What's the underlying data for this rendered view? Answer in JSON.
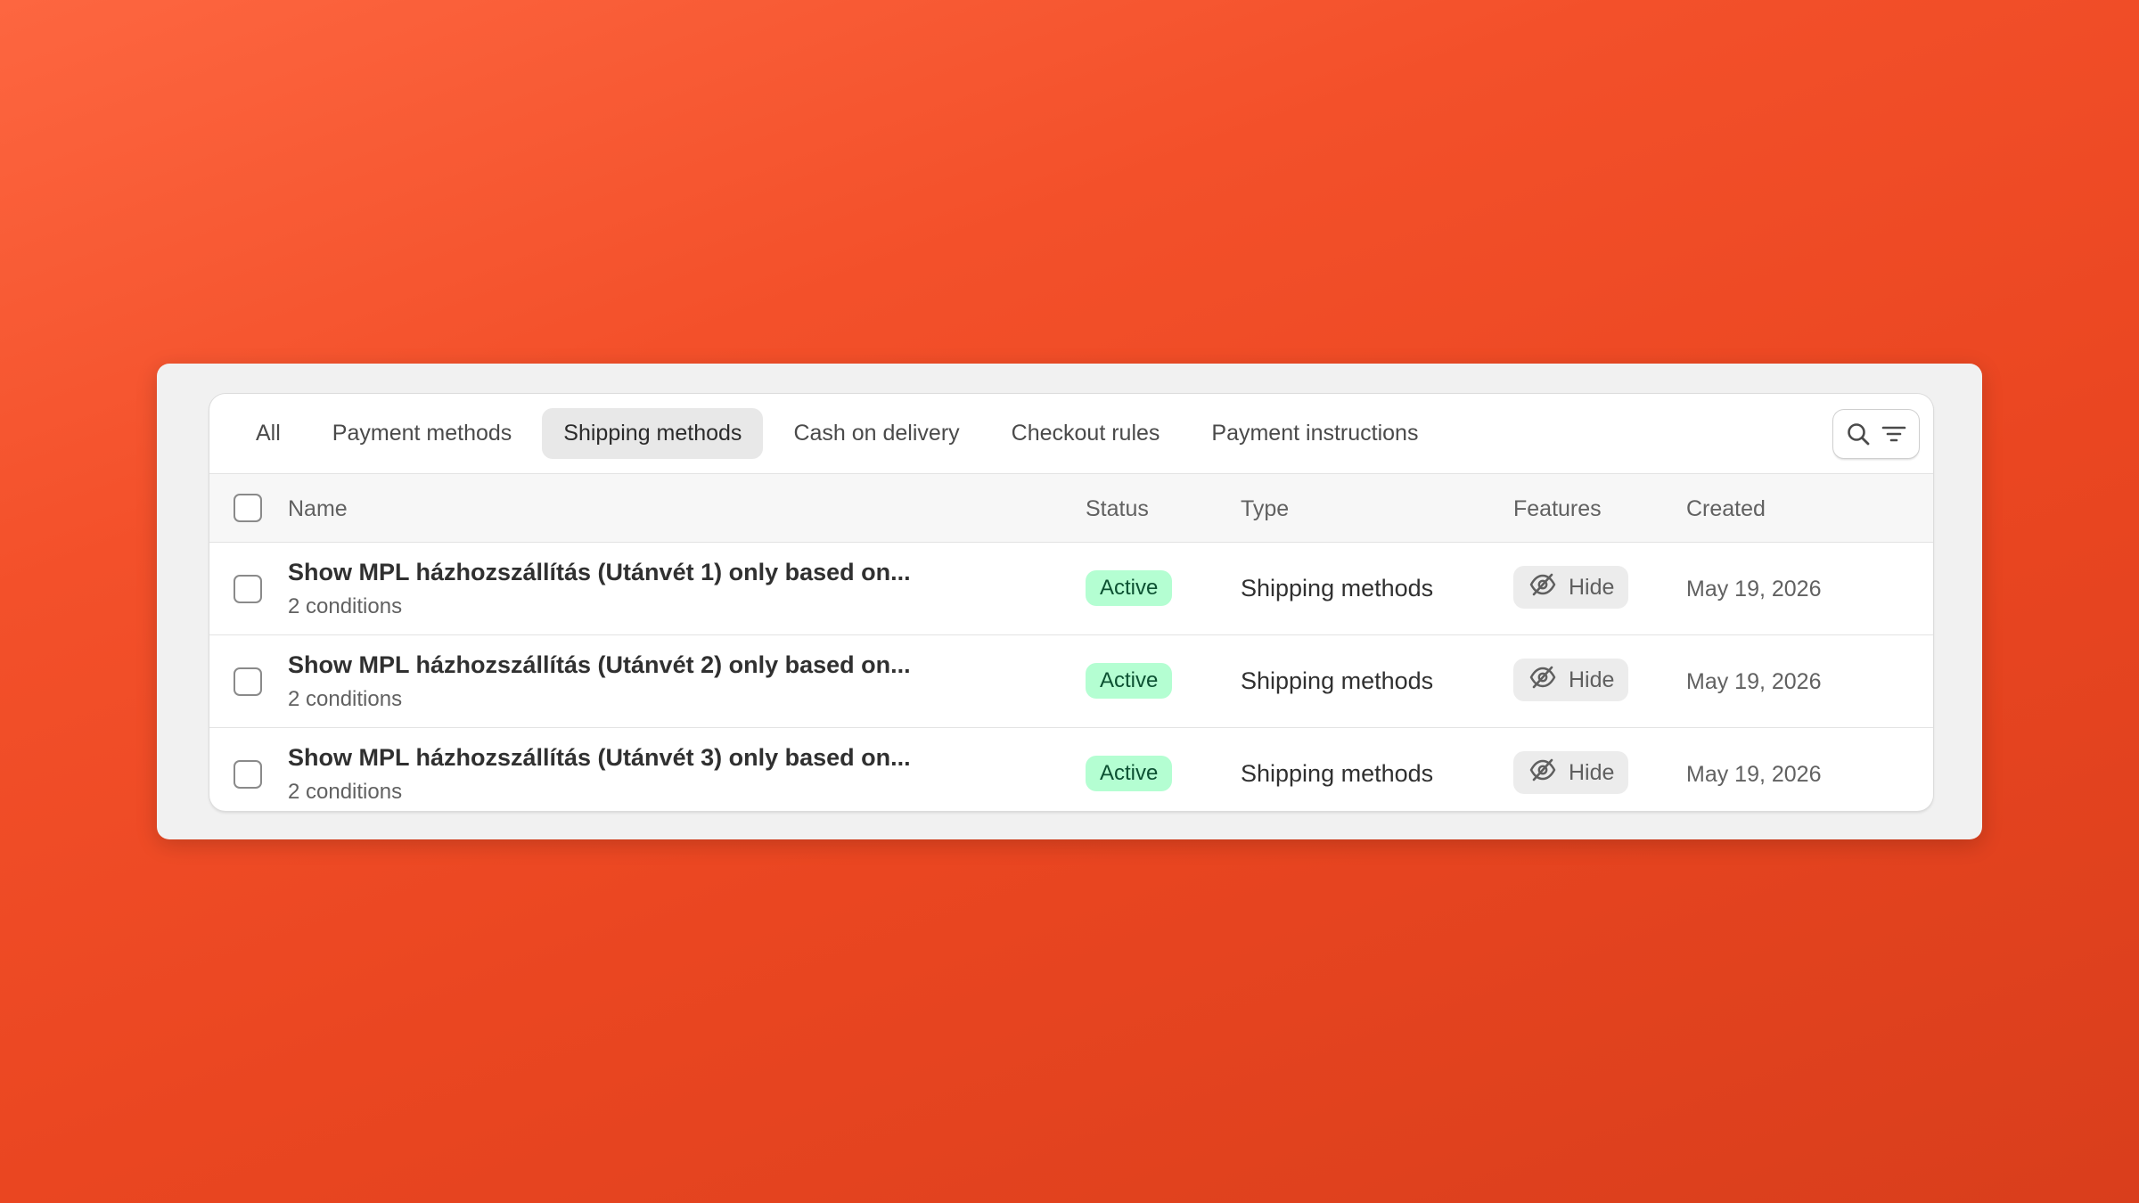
{
  "tabs": [
    {
      "label": "All",
      "active": false
    },
    {
      "label": "Payment methods",
      "active": false
    },
    {
      "label": "Shipping methods",
      "active": true
    },
    {
      "label": "Cash on delivery",
      "active": false
    },
    {
      "label": "Checkout rules",
      "active": false
    },
    {
      "label": "Payment instructions",
      "active": false
    }
  ],
  "toolbar": {
    "search_icon": "search-icon",
    "filter_icon": "filter-icon"
  },
  "table": {
    "columns": {
      "name": "Name",
      "status": "Status",
      "type": "Type",
      "features": "Features",
      "created": "Created"
    },
    "rows": [
      {
        "title": "Show MPL házhozszállítás (Utánvét 1) only based on...",
        "subtitle": "2 conditions",
        "status": "Active",
        "type": "Shipping methods",
        "feature": "Hide",
        "created": "May 19, 2026"
      },
      {
        "title": "Show MPL házhozszállítás (Utánvét 2) only based on...",
        "subtitle": "2 conditions",
        "status": "Active",
        "type": "Shipping methods",
        "feature": "Hide",
        "created": "May 19, 2026"
      },
      {
        "title": "Show MPL házhozszállítás (Utánvét 3) only based on...",
        "subtitle": "2 conditions",
        "status": "Active",
        "type": "Shipping methods",
        "feature": "Hide",
        "created": "May 19, 2026"
      }
    ]
  },
  "colors": {
    "background": "#f3502a",
    "badge_bg": "#b4fed2",
    "badge_text": "#0c5132",
    "active_tab_bg": "#e8e8e8"
  }
}
